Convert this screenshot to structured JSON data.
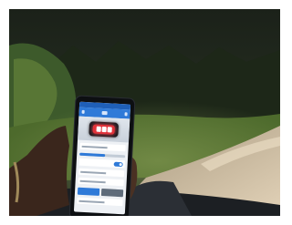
{
  "scene": {
    "description_colors": {
      "sky": "#232c22",
      "foliage": "#3f5b2c",
      "grass": "#5f7a35",
      "road": "#cdb89c",
      "dashboard": "#202327",
      "hand": "#3a261c"
    }
  },
  "phone_app": {
    "accent_color": "#2f7ad8",
    "light_color": "#e2333b",
    "icons": [
      "menu-icon",
      "settings-icon",
      "light-device-icon"
    ],
    "brightness_level": 0.55,
    "strobe_enabled": true
  }
}
